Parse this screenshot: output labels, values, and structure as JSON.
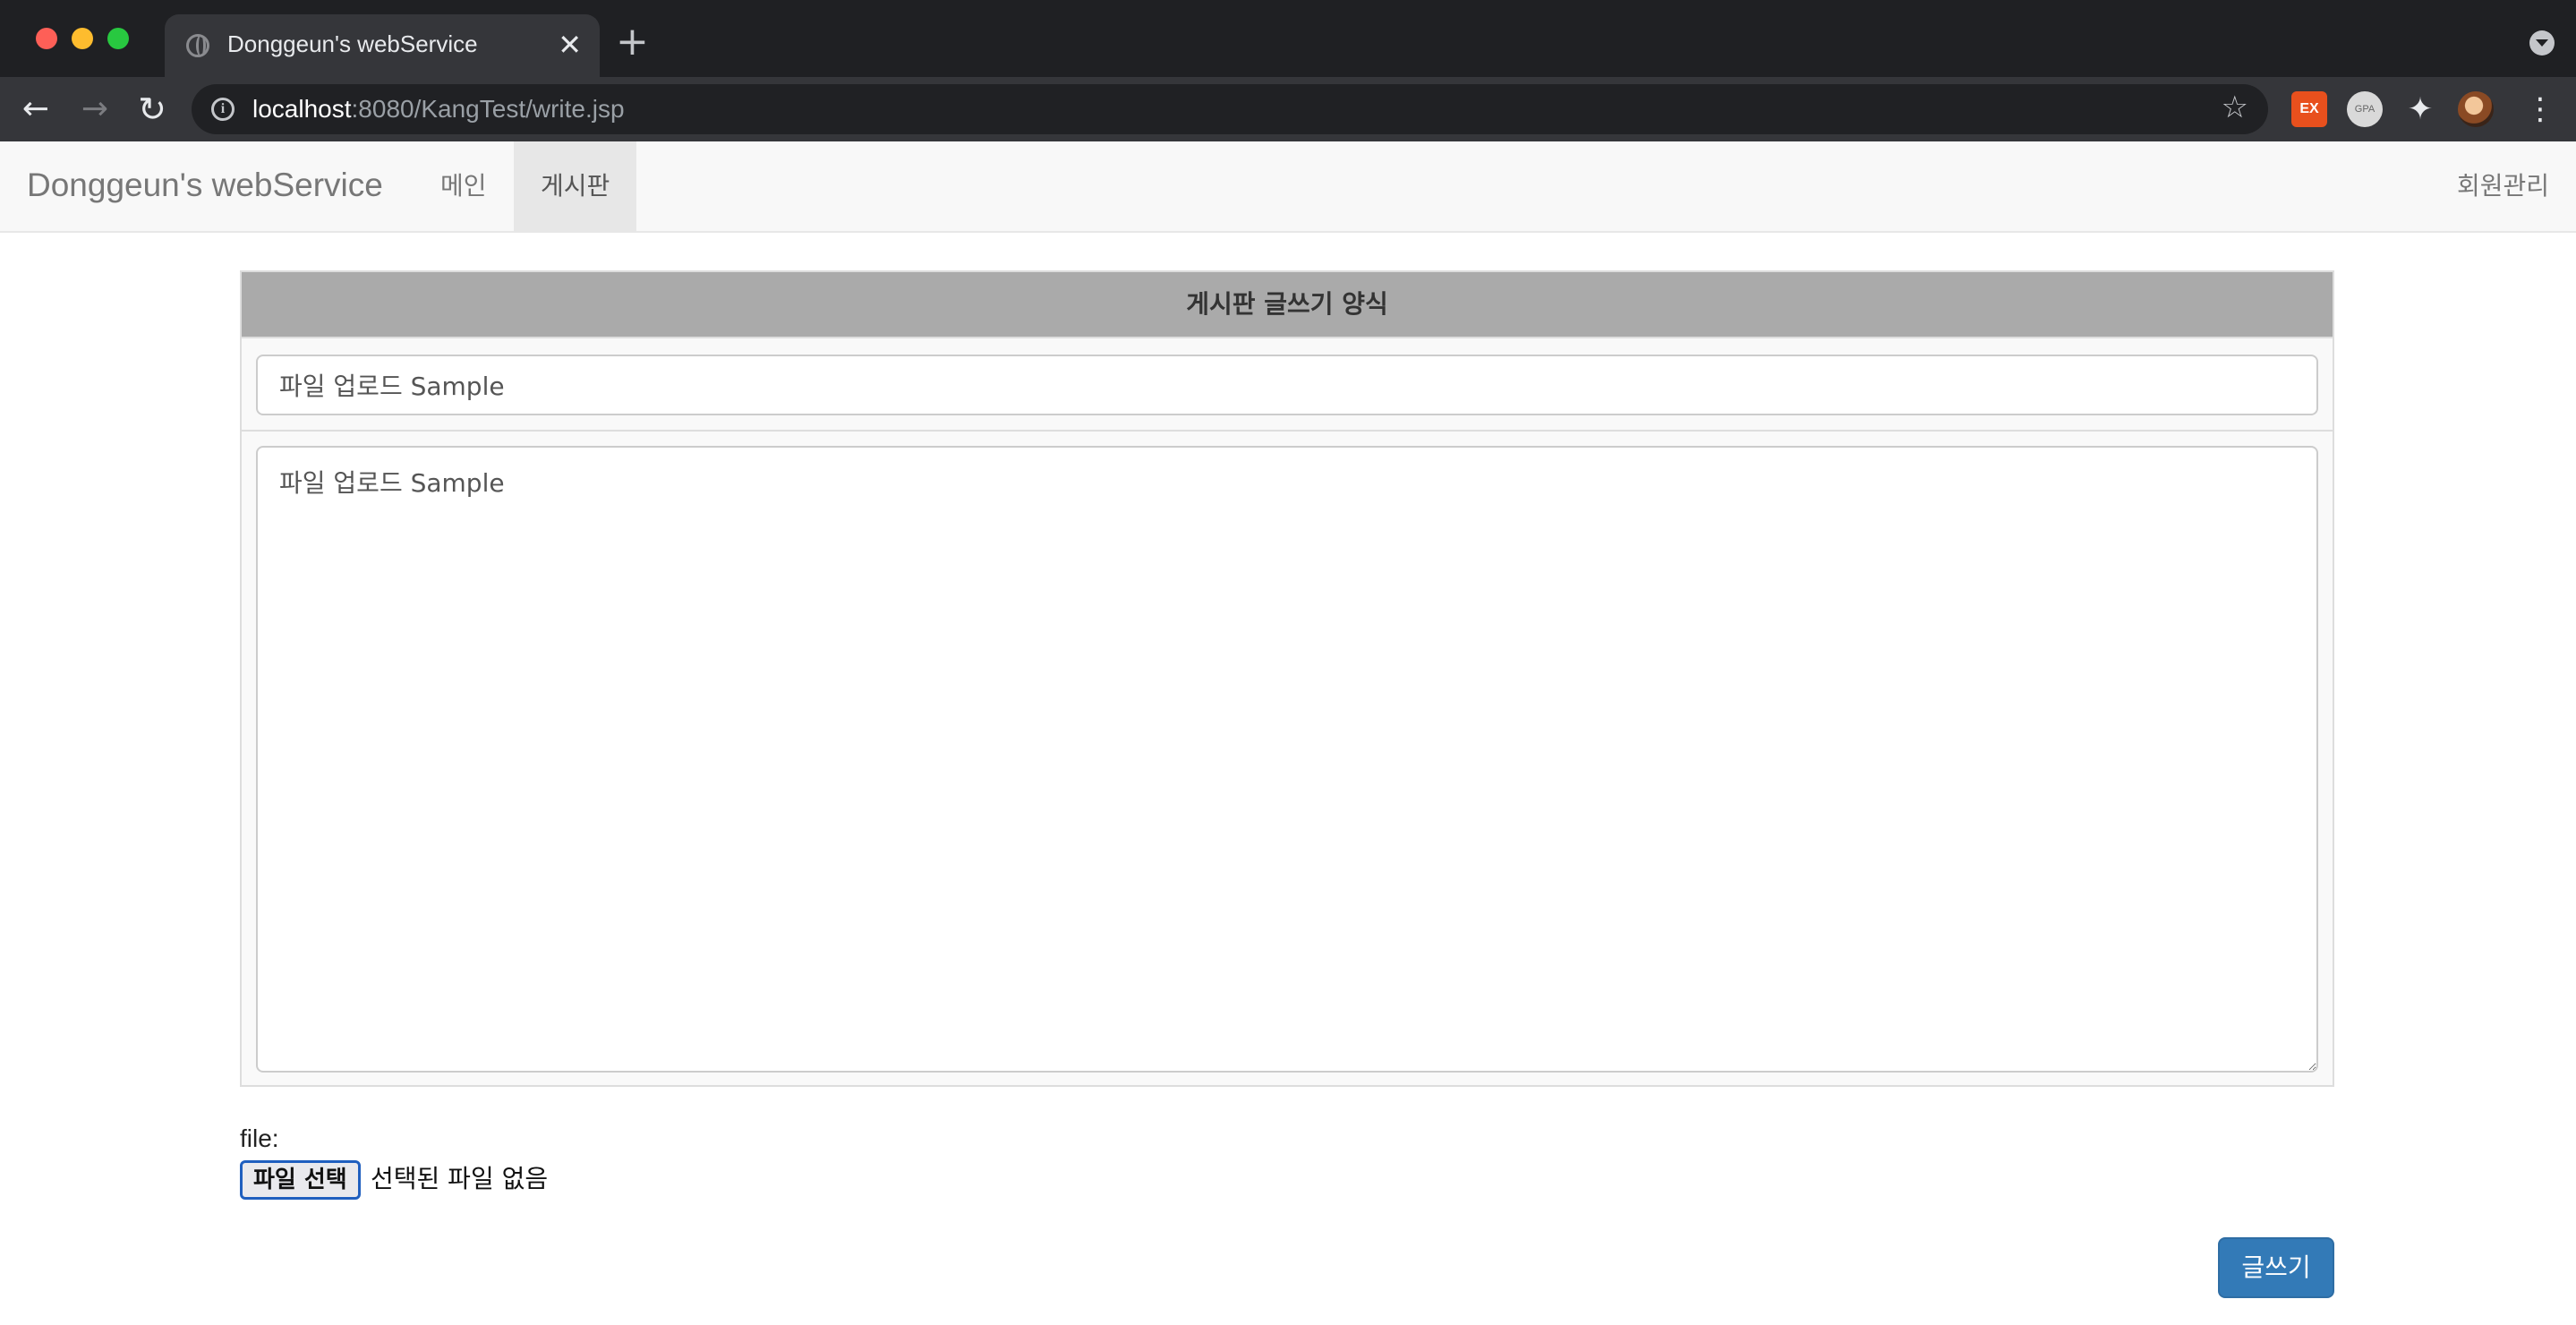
{
  "browser": {
    "tab_title": "Donggeun's webService",
    "tab_close": "✕",
    "new_tab": "+",
    "url_host": "localhost",
    "url_rest": ":8080/KangTest/write.jsp",
    "extensions": {
      "ex_label": "EX",
      "grey_label": "GPA"
    },
    "icons": [
      "back-arrow-icon",
      "forward-arrow-icon",
      "reload-icon",
      "info-icon",
      "star-icon",
      "puzzle-icon",
      "more-icon"
    ]
  },
  "navbar": {
    "brand": "Donggeun's webService",
    "links": [
      {
        "label": "메인",
        "active": false
      },
      {
        "label": "게시판",
        "active": true
      }
    ],
    "right_link": "회원관리"
  },
  "form": {
    "header": "게시판 글쓰기 양식",
    "title_value": "파일 업로드 Sample",
    "content_value": "파일 업로드 Sample",
    "file_label": "file:",
    "file_button": "파일 선택",
    "file_status": "선택된 파일 없음",
    "submit_label": "글쓰기"
  },
  "colors": {
    "header_bg": "#aaaaaa",
    "submit_bg": "#337ab7",
    "navbar_bg": "#f8f8f8"
  }
}
